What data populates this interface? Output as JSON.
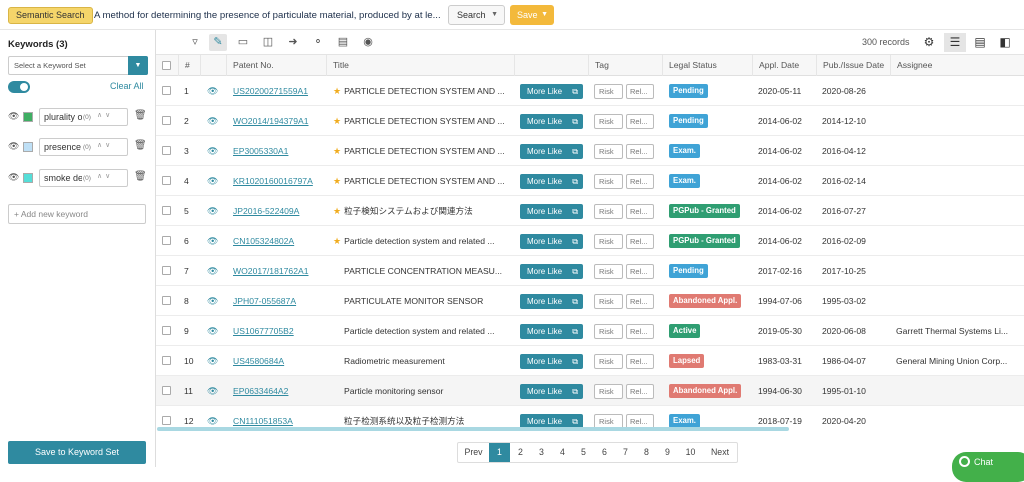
{
  "topbar": {
    "semantic_label": "Semantic Search",
    "query": "A method for determining the presence of particulate material, produced by at le...",
    "search_label": "Search",
    "save_label": "Save"
  },
  "sidebar": {
    "title": "Keywords (3)",
    "keyword_set_placeholder": "Select a Keyword Set",
    "clear_all": "Clear All",
    "keywords": [
      {
        "text": "plurality o",
        "count": "(0)",
        "color": "#3fae63"
      },
      {
        "text": "presence",
        "count": "(0)",
        "color": "#bfe0f6"
      },
      {
        "text": "smoke de",
        "count": "(0)",
        "color": "#55ded8"
      }
    ],
    "add_placeholder": "+ Add new keyword",
    "save_set_label": "Save to Keyword Set"
  },
  "toolbar": {
    "records": "300 records"
  },
  "table": {
    "headers": {
      "num": "#",
      "patent": "Patent No.",
      "title": "Title",
      "tag": "Tag",
      "legal": "Legal Status",
      "appl": "Appl. Date",
      "pub": "Pub./Issue Date",
      "assignee": "Assignee"
    },
    "more_like": "More Like",
    "risk": "Risk",
    "rel": "Rel...",
    "rows": [
      {
        "num": "1",
        "patent": "US20200271559A1",
        "starred": true,
        "title": "PARTICLE DETECTION SYSTEM AND ...",
        "status": "Pending",
        "status_color": "#3fa3d6",
        "appl": "2020-05-11",
        "pub": "2020-08-26",
        "assignee": ""
      },
      {
        "num": "2",
        "patent": "WO2014/194379A1",
        "starred": true,
        "title": "PARTICLE DETECTION SYSTEM AND ...",
        "status": "Pending",
        "status_color": "#3fa3d6",
        "appl": "2014-06-02",
        "pub": "2014-12-10",
        "assignee": ""
      },
      {
        "num": "3",
        "patent": "EP3005330A1",
        "starred": true,
        "title": "PARTICLE DETECTION SYSTEM AND ...",
        "status": "Exam.",
        "status_color": "#3fa3d6",
        "appl": "2014-06-02",
        "pub": "2016-04-12",
        "assignee": ""
      },
      {
        "num": "4",
        "patent": "KR1020160016797A",
        "starred": true,
        "title": "PARTICLE DETECTION SYSTEM AND ...",
        "status": "Exam.",
        "status_color": "#3fa3d6",
        "appl": "2014-06-02",
        "pub": "2016-02-14",
        "assignee": ""
      },
      {
        "num": "5",
        "patent": "JP2016-522409A",
        "starred": true,
        "title": "粒子検知システムおよび関連方法",
        "status": "PGPub - Granted",
        "status_color": "#2f9e72",
        "appl": "2014-06-02",
        "pub": "2016-07-27",
        "assignee": ""
      },
      {
        "num": "6",
        "patent": "CN105324802A",
        "starred": true,
        "title": "Particle detection system and related ...",
        "status": "PGPub - Granted",
        "status_color": "#2f9e72",
        "appl": "2014-06-02",
        "pub": "2016-02-09",
        "assignee": ""
      },
      {
        "num": "7",
        "patent": "WO2017/181762A1",
        "starred": false,
        "title": "PARTICLE CONCENTRATION MEASU...",
        "status": "Pending",
        "status_color": "#3fa3d6",
        "appl": "2017-02-16",
        "pub": "2017-10-25",
        "assignee": ""
      },
      {
        "num": "8",
        "patent": "JPH07-055687A",
        "starred": false,
        "title": "PARTICULATE MONITOR SENSOR",
        "status": "Abandoned Appl.",
        "status_color": "#e07a72",
        "appl": "1994-07-06",
        "pub": "1995-03-02",
        "assignee": ""
      },
      {
        "num": "9",
        "patent": "US10677705B2",
        "starred": false,
        "title": "Particle detection system and related ...",
        "status": "Active",
        "status_color": "#2f9e72",
        "appl": "2019-05-30",
        "pub": "2020-06-08",
        "assignee": "Garrett Thermal Systems Li..."
      },
      {
        "num": "10",
        "patent": "US4580684A",
        "starred": false,
        "title": "Radiometric measurement",
        "status": "Lapsed",
        "status_color": "#e07a72",
        "appl": "1983-03-31",
        "pub": "1986-04-07",
        "assignee": "General Mining Union Corp..."
      },
      {
        "num": "11",
        "patent": "EP0633464A2",
        "starred": false,
        "title": "Particle monitoring sensor",
        "status": "Abandoned Appl.",
        "status_color": "#e07a72",
        "appl": "1994-06-30",
        "pub": "1995-01-10",
        "assignee": ""
      },
      {
        "num": "12",
        "patent": "CN111051853A",
        "starred": false,
        "title": "粒子检测系统以及粒子检测方法",
        "status": "Exam.",
        "status_color": "#3fa3d6",
        "appl": "2018-07-19",
        "pub": "2020-04-20",
        "assignee": ""
      }
    ]
  },
  "pager": {
    "prev": "Prev",
    "next": "Next",
    "pages": [
      "1",
      "2",
      "3",
      "4",
      "5",
      "6",
      "7",
      "8",
      "9",
      "10"
    ],
    "current": "1"
  },
  "chat": {
    "label": "Chat"
  }
}
